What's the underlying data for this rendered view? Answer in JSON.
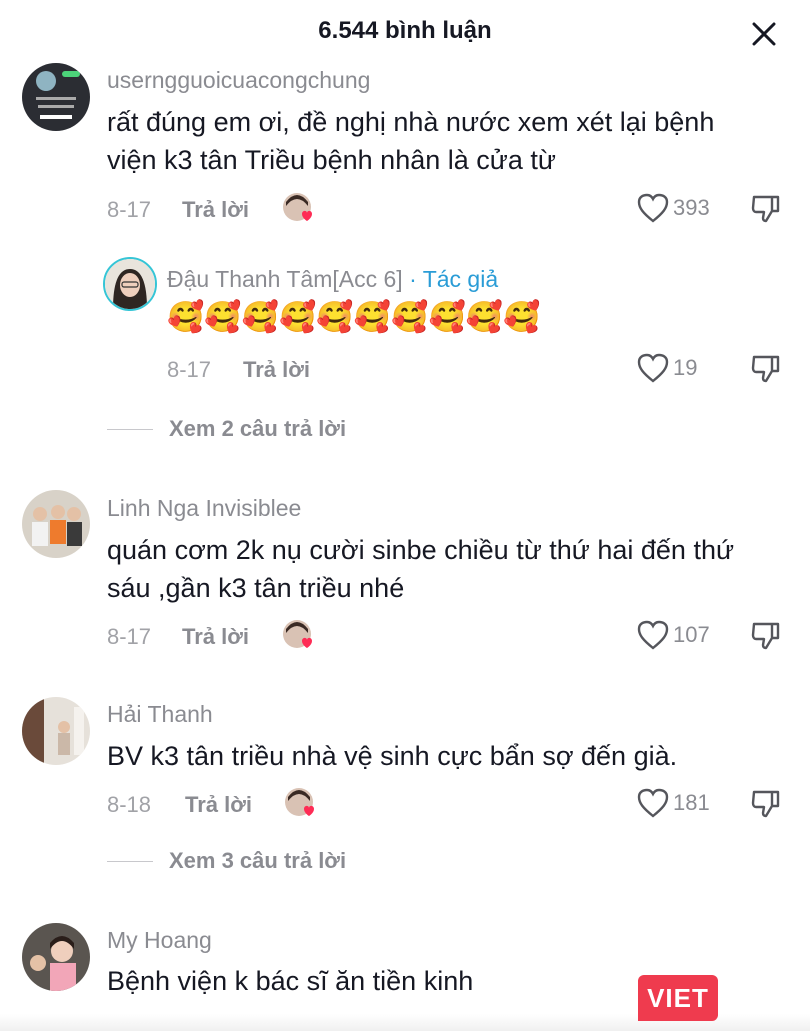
{
  "header": {
    "title": "6.544 bình luận",
    "close_icon": "close-icon"
  },
  "comments": [
    {
      "username": "userngguoicuacongchung",
      "text_lines": [
        "rất đúng em ơi, đề nghị nhà nước xem xét lại bệnh",
        "viện k3 tân Triều bệnh nhân là cửa từ"
      ],
      "date": "8-17",
      "reply_label": "Trả lời",
      "likes": "393"
    },
    {
      "username": "Đậu Thanh Tâm[Acc 6]",
      "author_tag": "· Tác giả",
      "emoji": "🥰🥰🥰🥰🥰🥰🥰🥰🥰🥰",
      "date": "8-17",
      "reply_label": "Trả lời",
      "likes": "19"
    },
    {
      "username": "Linh Nga Invisiblee",
      "text_lines": [
        "quán cơm 2k nụ cười sinbe chiều từ thứ hai đến thứ",
        "sáu ,gần k3 tân triều nhé"
      ],
      "date": "8-17",
      "reply_label": "Trả lời",
      "likes": "107"
    },
    {
      "username": "Hải Thanh",
      "text_lines": [
        "BV k3 tân triều nhà vệ sinh cực bẩn sợ đến già."
      ],
      "date": "8-18",
      "reply_label": "Trả lời",
      "likes": "181"
    },
    {
      "username": "My Hoang",
      "text_lines": [
        "Bệnh viện k bác sĩ ăn tiền kinh"
      ]
    }
  ],
  "view_replies": [
    "Xem 2 câu trả lời",
    "Xem 3 câu trả lời"
  ],
  "watermark": "VIET",
  "colors": {
    "author_tag": "#2a9cd6",
    "like_heart": "#fe2c55",
    "watermark": "#ef3b4e"
  }
}
